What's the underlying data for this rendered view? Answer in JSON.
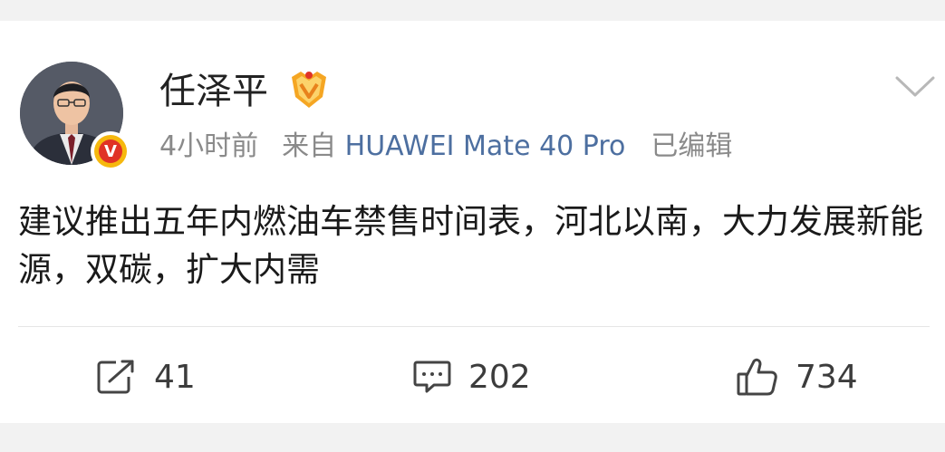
{
  "post": {
    "author": "任泽平",
    "time": "4小时前",
    "source_prefix": "来自",
    "source_device": "HUAWEI Mate 40 Pro",
    "edited": "已编辑",
    "text": "建议推出五年内燃油车禁售时间表，河北以南，大力发展新能源，双碳，扩大内需"
  },
  "actions": {
    "repost_count": "41",
    "comment_count": "202",
    "like_count": "734"
  },
  "icons": {
    "verified": "verified-v-badge-icon",
    "member": "member-crown-badge-icon",
    "menu": "chevron-down-icon",
    "repost": "repost-icon",
    "comment": "comment-icon",
    "like": "thumbs-up-icon"
  },
  "badges": {
    "verified_letter": "V"
  },
  "colors": {
    "link": "#4d6fa0",
    "verified_gold": "#f6b80e",
    "verified_red": "#e03326",
    "text": "#1a1a1a",
    "meta": "#8a8a8a"
  }
}
